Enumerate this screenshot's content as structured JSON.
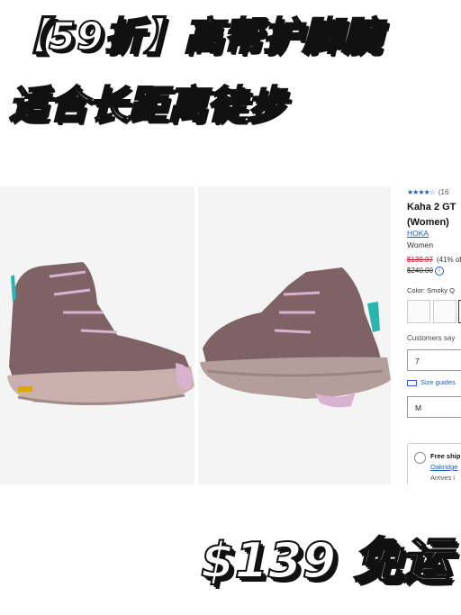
{
  "headline": {
    "line1": "【59折】高帮护脚腕",
    "line2": "适合长距离徒步",
    "price_banner": "$139 免运"
  },
  "product": {
    "stars": "★★★★☆",
    "rating_count": "(16",
    "title_line1": "Kaha 2 GT",
    "title_line2": "(Women)",
    "brand": "HOKA",
    "category": "Women",
    "sale_price": "$139.97",
    "discount": "(41% of",
    "original_price": "$240.00",
    "color_label": "Color: Smoky Q",
    "customers_say": "Customers say",
    "size_value": "7",
    "size_guides": "Size guides",
    "width_value": "M",
    "shipping_title": "Free ship",
    "shipping_store": "Oakridge",
    "shipping_arrival": "Arrives i"
  },
  "colors": {
    "boot_main": "#7e6265",
    "boot_sole": "#c9b0ad",
    "accent_pink": "#d9b2d0",
    "accent_teal": "#2bb5b0",
    "link_blue": "#1f5fb5",
    "sale_red": "#c0161f"
  }
}
